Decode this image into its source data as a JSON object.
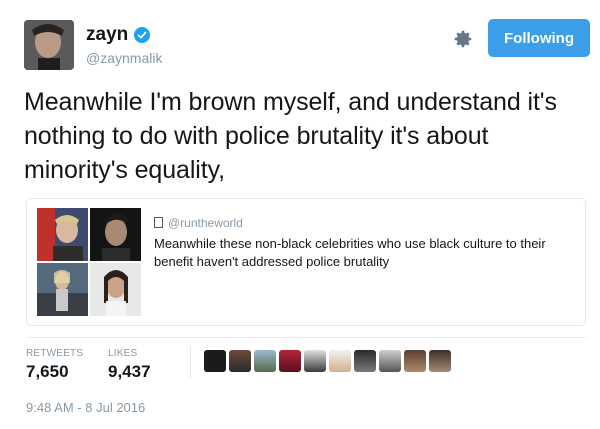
{
  "user": {
    "display_name": "zayn",
    "handle": "@zaynmalik"
  },
  "actions": {
    "follow_label": "Following"
  },
  "tweet": {
    "text": "Meanwhile I'm brown myself, and understand it's nothing to do with police brutality it's about minority's equality,"
  },
  "quoted_tweet": {
    "handle": "@runtheworld",
    "text": "Meanwhile these non-black celebrities who use black culture to their benefit haven't addressed police brutality"
  },
  "stats": {
    "retweets_label": "RETWEETS",
    "retweets_value": "7,650",
    "likes_label": "LIKES",
    "likes_value": "9,437"
  },
  "timestamp": "9:48 AM - 8 Jul 2016",
  "colors": {
    "accent": "#3a9ee8",
    "verified": "#1da1f2",
    "muted": "#8899a6"
  }
}
